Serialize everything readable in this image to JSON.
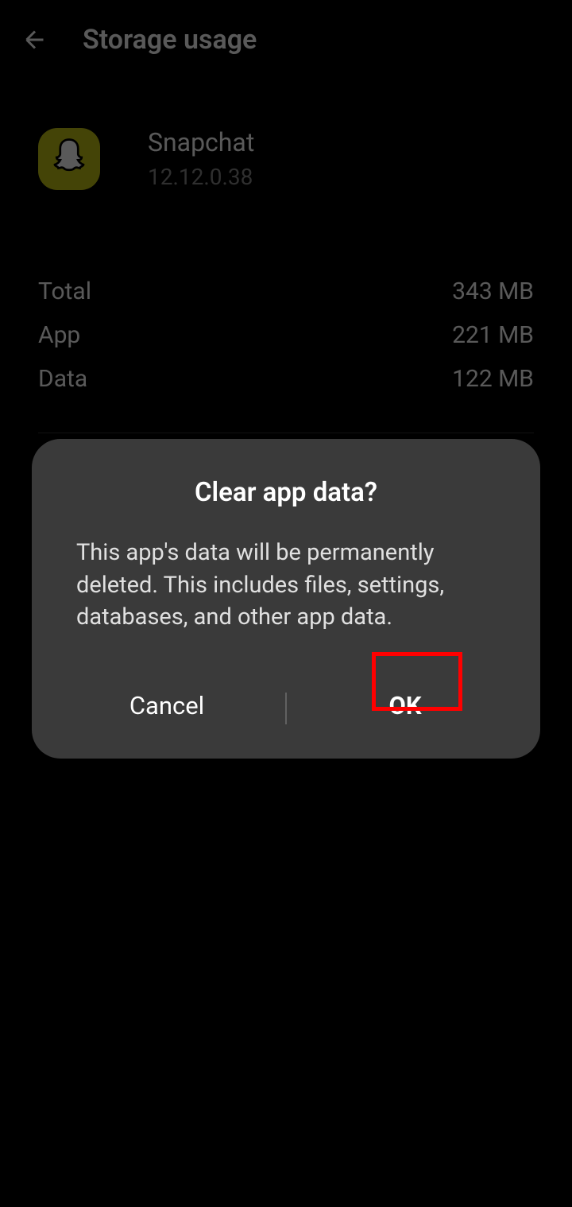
{
  "header": {
    "title": "Storage usage"
  },
  "app": {
    "name": "Snapchat",
    "version": "12.12.0.38"
  },
  "storage": {
    "rows": [
      {
        "label": "Total",
        "value": "343 MB"
      },
      {
        "label": "App",
        "value": "221 MB"
      },
      {
        "label": "Data",
        "value": "122 MB"
      }
    ]
  },
  "dialog": {
    "title": "Clear app data?",
    "message": "This app's data will be permanently deleted. This includes files, settings, databases, and other app data.",
    "cancel_label": "Cancel",
    "ok_label": "OK"
  }
}
